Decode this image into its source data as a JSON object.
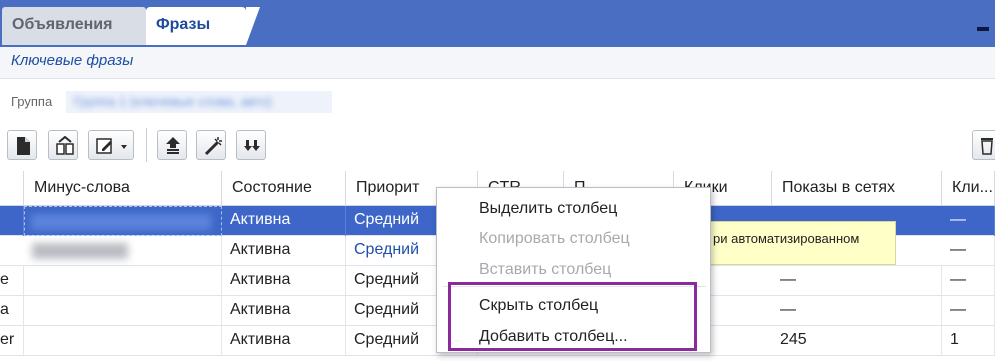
{
  "tabs": [
    {
      "label": "Объявления",
      "active": false
    },
    {
      "label": "Фразы",
      "active": true
    }
  ],
  "header": {
    "title": "Ключевые фразы"
  },
  "group": {
    "label": "Группа",
    "value": "Группа 1 (ключевые слова, авто)"
  },
  "toolbar": {
    "buttons": [
      "document-icon",
      "copy-group-icon",
      "edit-menu-icon",
      "move-up-icon",
      "magic-wand-icon",
      "move-down-icon",
      "delete-icon"
    ]
  },
  "grid": {
    "columns": [
      "",
      "Минус-слова",
      "Состояние",
      "Приорит",
      "CTR",
      "П",
      "Клики",
      "Показы в сетях",
      "Кли..."
    ],
    "rows": [
      {
        "first": "",
        "minus": "",
        "state": "Активна",
        "priority": "Средний",
        "views": "",
        "clicks": "—",
        "selected": true
      },
      {
        "first": "",
        "minus": "",
        "state": "Активна",
        "priority": "Средний",
        "views": "",
        "clicks": "—",
        "selected": false
      },
      {
        "first": "e",
        "minus": "",
        "state": "Активна",
        "priority": "Средний",
        "views": "—",
        "clicks": "—",
        "selected": false
      },
      {
        "first": "a",
        "minus": "",
        "state": "Активна",
        "priority": "Средний",
        "views": "—",
        "clicks": "—",
        "selected": false
      },
      {
        "first": "er",
        "minus": "",
        "state": "Активна",
        "priority": "Средний",
        "views": "245",
        "clicks": "1",
        "selected": false
      }
    ]
  },
  "tooltip": {
    "text": "ри автоматизированном"
  },
  "context_menu": {
    "items": [
      {
        "label": "Выделить столбец",
        "enabled": true
      },
      {
        "label": "Копировать столбец",
        "enabled": false
      },
      {
        "label": "Вставить столбец",
        "enabled": false
      },
      {
        "label": "Скрыть столбец",
        "enabled": true
      },
      {
        "label": "Добавить столбец...",
        "enabled": true
      }
    ]
  },
  "colors": {
    "tabbar": "#4a6fc2",
    "selected_row": "#3d66c8",
    "highlight_border": "#8b2a9a",
    "tooltip_bg": "#ffffc8"
  }
}
